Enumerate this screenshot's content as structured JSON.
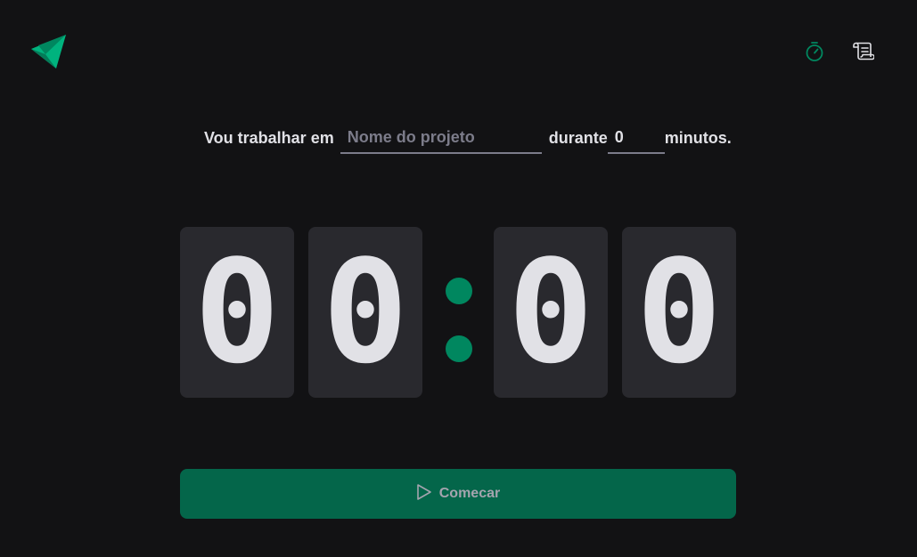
{
  "header": {
    "logo_icon": "ignite-logo-icon",
    "nav": [
      {
        "icon": "timer-icon",
        "color": "#00875f"
      },
      {
        "icon": "scroll-icon",
        "color": "#e1e1e6"
      }
    ]
  },
  "form": {
    "label_work_on": "Vou trabalhar em",
    "task_placeholder": "Nome do projeto",
    "task_value": "",
    "label_during": "durante",
    "minutes_value": "0",
    "label_minutes": "minutos."
  },
  "countdown": {
    "minutes_tens": "0",
    "minutes_ones": "0",
    "seconds_tens": "0",
    "seconds_ones": "0"
  },
  "start_button": {
    "label": "Comecar",
    "icon": "play-icon"
  },
  "colors": {
    "background": "#121214",
    "accent": "#00875f",
    "accent_dark": "#04664a",
    "digit_bg": "#29292e",
    "text": "#e1e1e6",
    "muted": "#7c7c8a"
  }
}
